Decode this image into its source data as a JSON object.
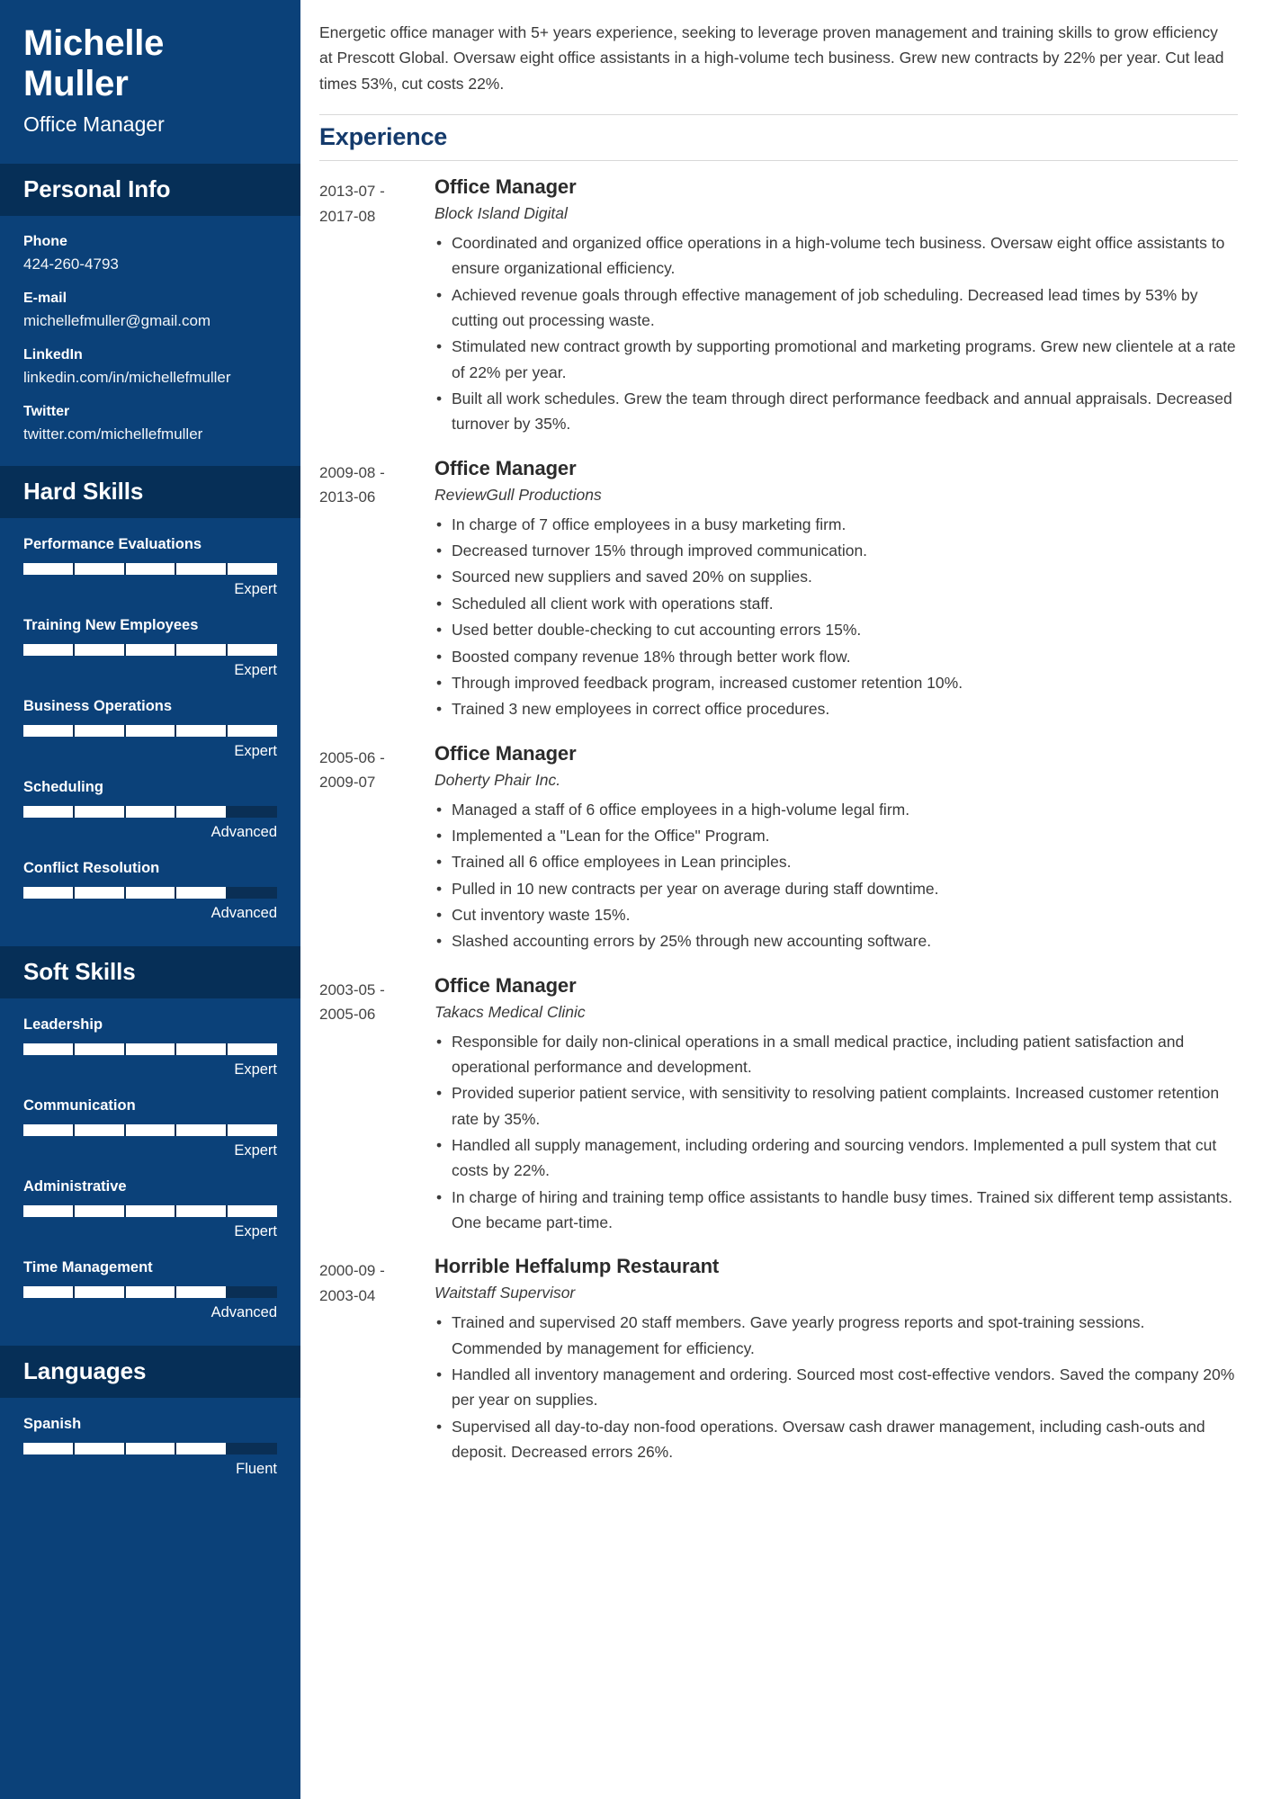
{
  "colors": {
    "sidebar_bg": "#0b4179",
    "sidebar_header_bg": "#062f57",
    "accent_heading": "#143a6b",
    "bar_on": "#ffffff",
    "bar_off": "#0a2f55"
  },
  "header": {
    "name": "Michelle Muller",
    "title": "Office Manager"
  },
  "sidebar": {
    "personal_info": {
      "heading": "Personal Info",
      "items": [
        {
          "label": "Phone",
          "value": "424-260-4793"
        },
        {
          "label": "E-mail",
          "value": "michellefmuller@gmail.com"
        },
        {
          "label": "LinkedIn",
          "value": "linkedin.com/in/michellefmuller"
        },
        {
          "label": "Twitter",
          "value": "twitter.com/michellefmuller"
        }
      ]
    },
    "hard_skills": {
      "heading": "Hard Skills",
      "items": [
        {
          "name": "Performance Evaluations",
          "level": "Expert",
          "filled": 5,
          "total": 5
        },
        {
          "name": "Training New Employees",
          "level": "Expert",
          "filled": 5,
          "total": 5
        },
        {
          "name": "Business Operations",
          "level": "Expert",
          "filled": 5,
          "total": 5
        },
        {
          "name": "Scheduling",
          "level": "Advanced",
          "filled": 4,
          "total": 5
        },
        {
          "name": "Conflict Resolution",
          "level": "Advanced",
          "filled": 4,
          "total": 5
        }
      ]
    },
    "soft_skills": {
      "heading": "Soft Skills",
      "items": [
        {
          "name": "Leadership",
          "level": "Expert",
          "filled": 5,
          "total": 5
        },
        {
          "name": "Communication",
          "level": "Expert",
          "filled": 5,
          "total": 5
        },
        {
          "name": "Administrative",
          "level": "Expert",
          "filled": 5,
          "total": 5
        },
        {
          "name": "Time Management",
          "level": "Advanced",
          "filled": 4,
          "total": 5
        }
      ]
    },
    "languages": {
      "heading": "Languages",
      "items": [
        {
          "name": "Spanish",
          "level": "Fluent",
          "filled": 4,
          "total": 5
        }
      ]
    }
  },
  "main": {
    "summary": "Energetic office manager with 5+ years experience, seeking to leverage proven management and training skills to grow efficiency at Prescott Global. Oversaw eight office assistants in a high-volume tech business. Grew new contracts by 22% per year. Cut lead times 53%, cut costs 22%.",
    "experience_heading": "Experience",
    "jobs": [
      {
        "date_start": "2013-07 -",
        "date_end": "2017-08",
        "role": "Office Manager",
        "company": "Block Island Digital",
        "bullets": [
          "Coordinated and organized office operations in a high-volume tech business. Oversaw eight office assistants to ensure organizational efficiency.",
          "Achieved revenue goals through effective management of job scheduling. Decreased lead times by 53% by cutting out processing waste.",
          "Stimulated new contract growth by supporting promotional and marketing programs. Grew new clientele at a rate of 22% per year.",
          "Built all work schedules. Grew the team through direct performance feedback and annual appraisals. Decreased turnover by 35%."
        ]
      },
      {
        "date_start": "2009-08 -",
        "date_end": "2013-06",
        "role": "Office Manager",
        "company": "ReviewGull Productions",
        "bullets": [
          "In charge of 7 office employees in a busy marketing firm.",
          "Decreased turnover 15% through improved communication.",
          "Sourced new suppliers and saved 20% on supplies.",
          "Scheduled all client work with operations staff.",
          "Used better double-checking to cut accounting errors 15%.",
          "Boosted company revenue 18% through better work flow.",
          "Through improved feedback program, increased customer retention 10%.",
          "Trained 3 new employees in correct office procedures."
        ]
      },
      {
        "date_start": "2005-06 -",
        "date_end": "2009-07",
        "role": "Office Manager",
        "company": "Doherty Phair Inc.",
        "bullets": [
          "Managed a staff of 6 office employees in a high-volume legal firm.",
          "Implemented a \"Lean for the Office\" Program.",
          "Trained all 6 office employees in Lean principles.",
          "Pulled in 10 new contracts per year on average during staff downtime.",
          "Cut inventory waste 15%.",
          "Slashed accounting errors by 25% through new accounting software."
        ]
      },
      {
        "date_start": "2003-05 -",
        "date_end": "2005-06",
        "role": "Office Manager",
        "company": "Takacs Medical Clinic",
        "bullets": [
          "Responsible for daily non-clinical operations in a small medical practice, including patient satisfaction and operational performance and development.",
          "Provided superior patient service, with sensitivity to resolving patient complaints. Increased customer retention rate by 35%.",
          "Handled all supply management, including ordering and sourcing vendors. Implemented a pull system that cut costs by 22%.",
          "In charge of hiring and training temp office assistants to handle busy times. Trained six different temp assistants. One became part-time."
        ]
      },
      {
        "date_start": "2000-09 -",
        "date_end": "2003-04",
        "role": "Horrible Heffalump Restaurant",
        "company": "Waitstaff Supervisor",
        "bullets": [
          "Trained and supervised 20 staff members. Gave yearly progress reports and spot-training sessions. Commended by management for efficiency.",
          "Handled all inventory management and ordering. Sourced most cost-effective vendors. Saved the company 20% per year on supplies.",
          "Supervised all day-to-day non-food operations. Oversaw cash drawer management, including cash-outs and deposit. Decreased errors 26%."
        ]
      }
    ]
  }
}
